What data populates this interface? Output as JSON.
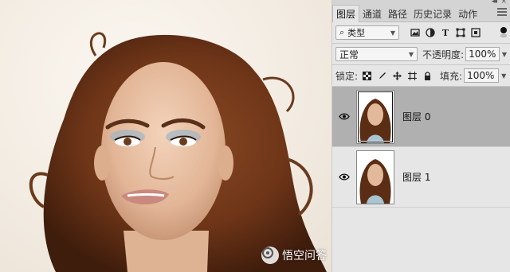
{
  "panel": {
    "tabs": [
      {
        "label": "图层",
        "active": true
      },
      {
        "label": "通道",
        "active": false
      },
      {
        "label": "路径",
        "active": false
      },
      {
        "label": "历史记录",
        "active": false
      },
      {
        "label": "动作",
        "active": false
      }
    ],
    "window_controls": {
      "collapse": "◂◂",
      "close": "×"
    },
    "filter": {
      "icon": "search-icon",
      "value": "类型"
    },
    "blend_mode": "正常",
    "opacity_label": "不透明度:",
    "opacity_value": "100%",
    "lock_label": "锁定:",
    "fill_label": "填充:",
    "fill_value": "100%",
    "layers": [
      {
        "name": "图层 0",
        "visible": true,
        "selected": true
      },
      {
        "name": "图层 1",
        "visible": true,
        "selected": false
      }
    ]
  },
  "watermark": {
    "text": "悟空问答"
  },
  "colors": {
    "panel_bg": "#e6e6e6",
    "selected_layer": "#b0b0b0",
    "hair": "#6b3a1c",
    "skin": "#e8c2a6"
  }
}
